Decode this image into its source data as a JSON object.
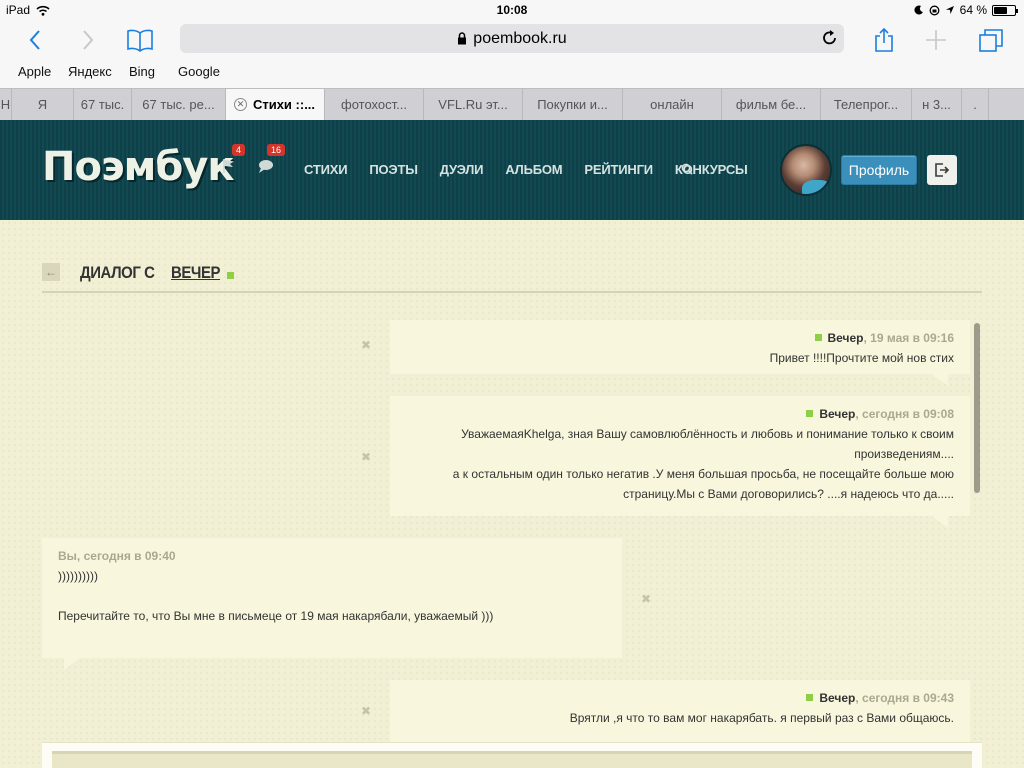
{
  "status_bar": {
    "device": "iPad",
    "time": "10:08",
    "battery": "64 %",
    "battery_level": 0.64
  },
  "browser": {
    "url": "poembook.ru",
    "favorites": [
      "Apple",
      "Яндекс",
      "Bing",
      "Google"
    ],
    "tabs": [
      {
        "label": "Н",
        "active": false
      },
      {
        "label": "Я",
        "active": false
      },
      {
        "label": "67 тыс.",
        "active": false
      },
      {
        "label": "67 тыс. ре...",
        "active": false
      },
      {
        "label": "Стихи ::...",
        "active": true
      },
      {
        "label": "фотохост...",
        "active": false
      },
      {
        "label": "VFL.Ru эт...",
        "active": false
      },
      {
        "label": "Покупки и...",
        "active": false
      },
      {
        "label": "онлайн",
        "active": false
      },
      {
        "label": "фильм бе...",
        "active": false
      },
      {
        "label": "Телепрог...",
        "active": false
      },
      {
        "label": "н 3...",
        "active": false
      },
      {
        "label": ".",
        "active": false
      }
    ]
  },
  "site": {
    "logo": "Поэмбук",
    "notifications": {
      "flags": "4",
      "messages": "16"
    },
    "nav": [
      "СТИХИ",
      "ПОЭТЫ",
      "ДУЭЛИ",
      "АЛЬБОМ",
      "РЕЙТИНГИ",
      "КОНКУРСЫ"
    ],
    "profile_button": "Профиль"
  },
  "dialog": {
    "back": "←",
    "title": "ДИАЛОГ С",
    "user": "ВЕЧЕР",
    "messages": [
      {
        "direction": "in",
        "author": "Вечер",
        "time": ", 19 мая в 09:16",
        "lines": [
          "Привет !!!!Прочтите мой нов стих"
        ]
      },
      {
        "direction": "in",
        "author": "Вечер",
        "time": ", сегодня в 09:08",
        "lines": [
          "УважаемаяKhelga, зная Вашу самовлюблённость и любовь и понимание только к своим",
          "произведениям....",
          "а к остальным один только негатив .У меня большая просьба, не посещайте больше мою",
          "страницу.Мы с Вами договорились? ....я надеюсь что да....."
        ]
      },
      {
        "direction": "out",
        "author": "Вы",
        "time": ", сегодня в 09:40",
        "lines": [
          "))))))))))",
          "",
          "Перечитайте то, что Вы мне в письмеце от 19 мая накарябали, уважаемый )))"
        ]
      },
      {
        "direction": "in",
        "author": "Вечер",
        "time": ", сегодня в 09:43",
        "lines": [
          "Врятли ,я что то вам мог накарябать. я первый раз с Вами общаюсь."
        ]
      }
    ],
    "delete_glyph": "✖"
  }
}
